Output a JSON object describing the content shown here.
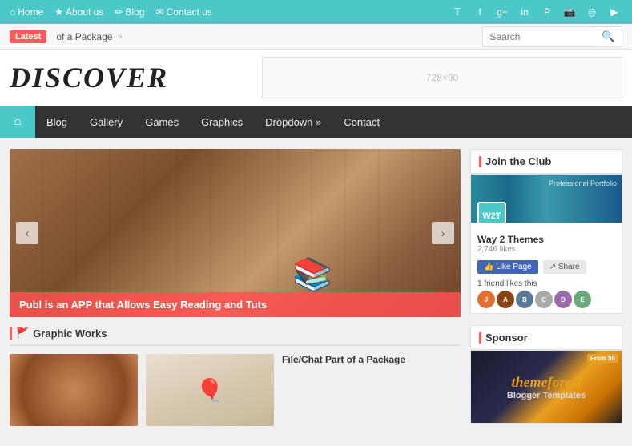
{
  "topbar": {
    "nav": [
      {
        "label": "Home",
        "icon": "home-icon"
      },
      {
        "label": "About us",
        "icon": "star-icon"
      },
      {
        "label": "Blog",
        "icon": "pencil-icon"
      },
      {
        "label": "Contact us",
        "icon": "envelope-icon"
      }
    ],
    "social": [
      "twitter",
      "facebook",
      "googleplus",
      "linkedin",
      "pinterest",
      "instagram",
      "dribbble",
      "youtube"
    ]
  },
  "ticker": {
    "label": "Latest",
    "text": "of a Package",
    "arrow": "»"
  },
  "search": {
    "placeholder": "Search"
  },
  "header": {
    "logo": "DISCOVER",
    "ad_text": "728×90"
  },
  "nav": {
    "home_icon": "⌂",
    "items": [
      {
        "label": "Blog"
      },
      {
        "label": "Gallery"
      },
      {
        "label": "Games"
      },
      {
        "label": "Graphics"
      },
      {
        "label": "Dropdown »"
      },
      {
        "label": "Contact"
      }
    ]
  },
  "slider": {
    "caption": "Publ is an APP that Allows Easy Reading and Tuts",
    "prev_label": "‹",
    "next_label": "›"
  },
  "graphic_works": {
    "section_label": "Graphic Works",
    "posts": [
      {
        "thumb_type": "cinnamon",
        "title": "",
        "excerpt": ""
      },
      {
        "thumb_type": "balloon",
        "thumb_emoji": "🎈",
        "title": "File/Chat Part of a Package",
        "excerpt": ""
      }
    ]
  },
  "sidebar": {
    "join_widget": {
      "title": "Join the Club",
      "page_name": "Way 2 Themes",
      "likes": "2,746 likes",
      "avatar_text": "W2T",
      "like_btn": "👍 Like Page",
      "share_btn": "↗ Share",
      "friend_text": "1 friend likes this",
      "friend_avatars": [
        "J",
        "A",
        "B",
        "C",
        "D",
        "E"
      ]
    },
    "sponsor_widget": {
      "title": "Sponsor",
      "corner_text": "From $5",
      "brand": "themeforest",
      "sub": "Blogger Templates"
    }
  }
}
